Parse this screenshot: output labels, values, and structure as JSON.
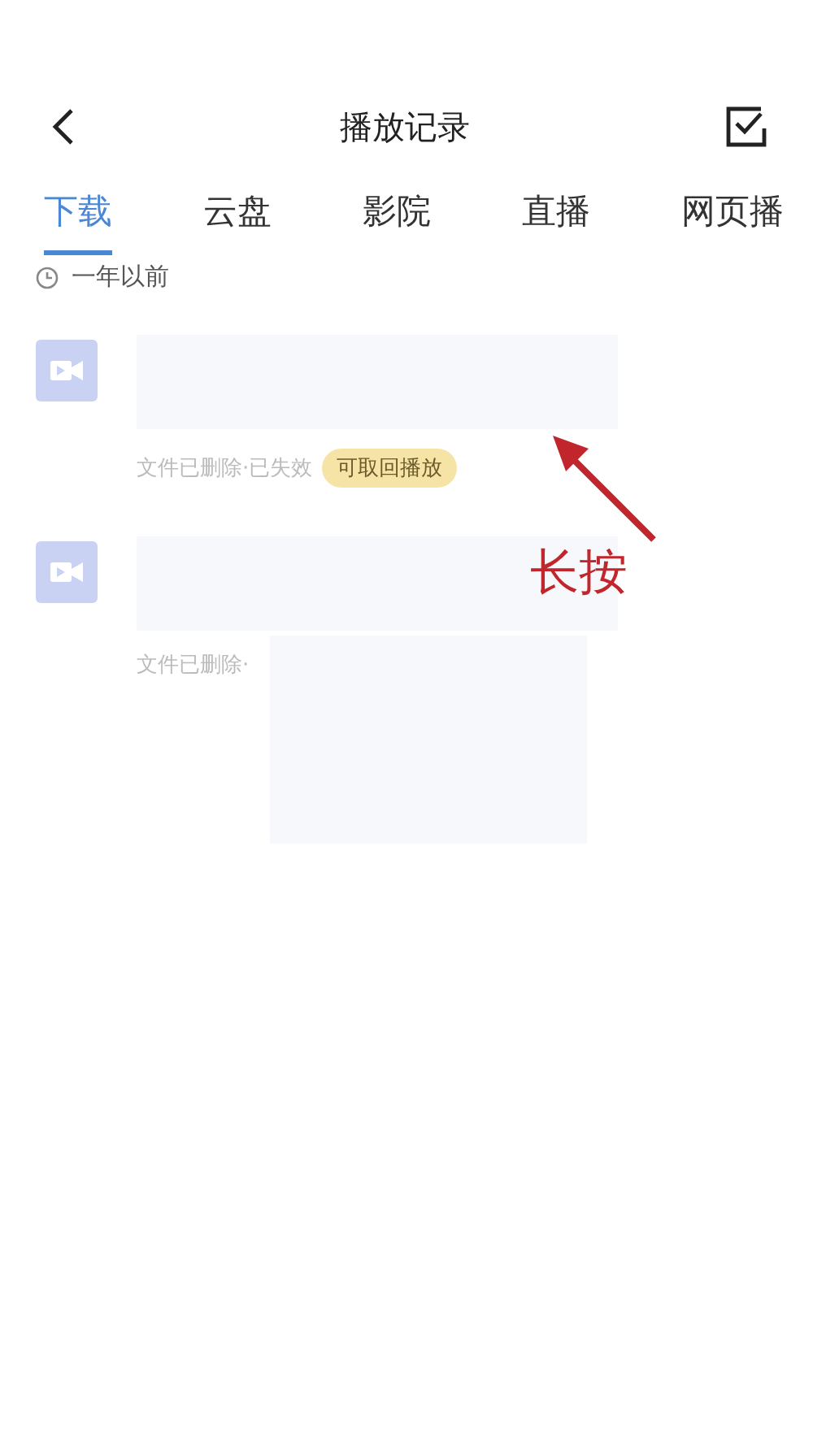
{
  "header": {
    "title": "播放记录"
  },
  "tabs": [
    {
      "label": "下载",
      "selected": true
    },
    {
      "label": "云盘",
      "selected": false
    },
    {
      "label": "影院",
      "selected": false
    },
    {
      "label": "直播",
      "selected": false
    },
    {
      "label": "网页播",
      "selected": false
    }
  ],
  "section": {
    "label": "一年以前"
  },
  "items": [
    {
      "status": "文件已删除·已失效",
      "badge": "可取回播放"
    },
    {
      "status": "文件已删除·"
    }
  ],
  "annotation": {
    "label": "长按"
  }
}
